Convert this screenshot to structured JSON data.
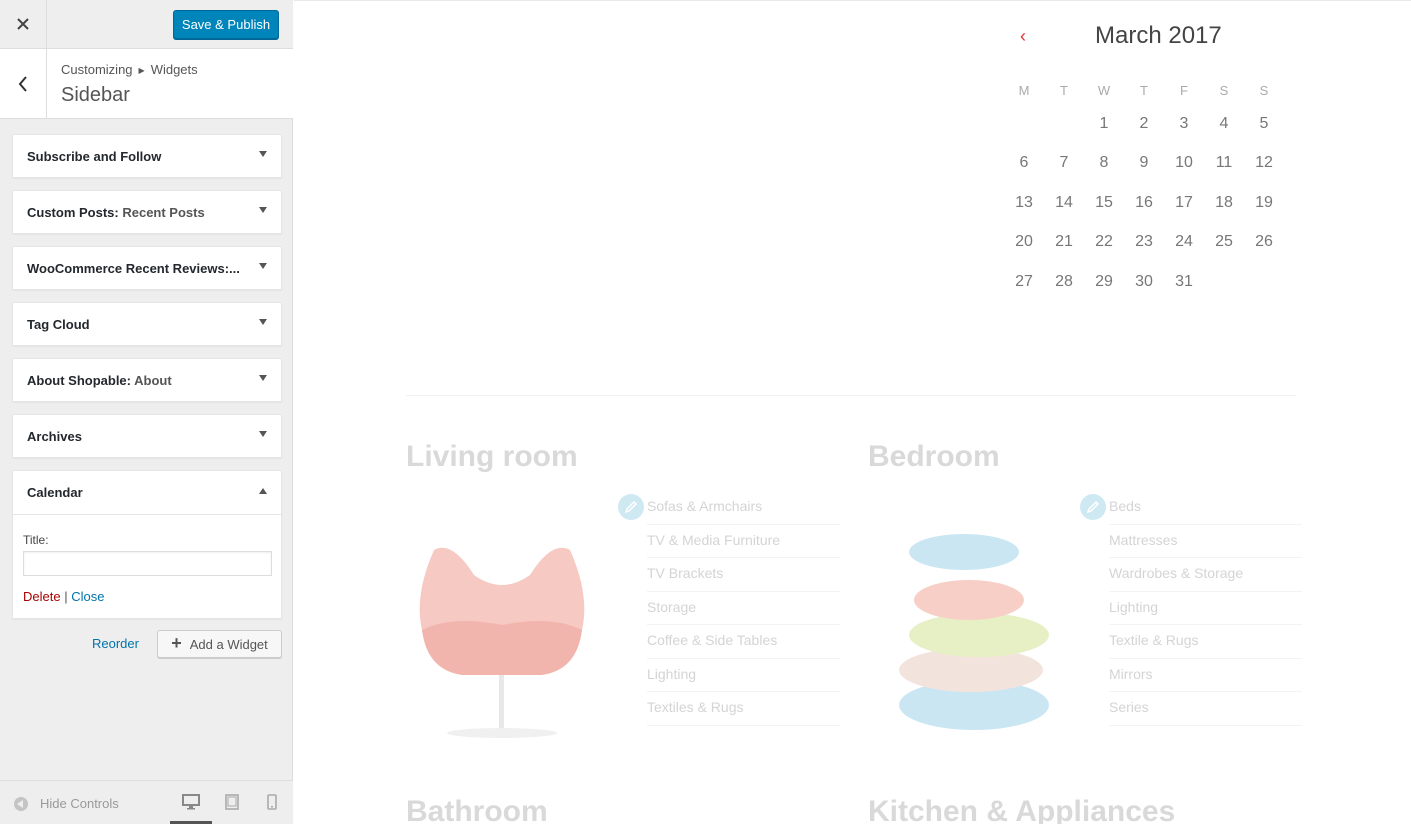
{
  "header": {
    "close_icon": "close-icon",
    "publish_label": "Save & Publish"
  },
  "section": {
    "breadcrumb": [
      "Customizing",
      "Widgets"
    ],
    "title": "Sidebar"
  },
  "widgets": [
    {
      "title": "Subscribe and Follow",
      "subtitle": ""
    },
    {
      "title": "Custom Posts:",
      "subtitle": " Recent Posts"
    },
    {
      "title": "WooCommerce Recent Reviews:...",
      "subtitle": ""
    },
    {
      "title": "Tag Cloud",
      "subtitle": ""
    },
    {
      "title": "About Shopable:",
      "subtitle": " About"
    },
    {
      "title": "Archives",
      "subtitle": ""
    }
  ],
  "calendar_widget": {
    "title": "Calendar",
    "field_label": "Title:",
    "field_value": "",
    "delete_label": "Delete",
    "separator": "|",
    "close_label": "Close"
  },
  "footer_actions": {
    "reorder_label": "Reorder",
    "add_widget_label": "Add a Widget"
  },
  "footer": {
    "hide_controls_label": "Hide Controls",
    "devices": [
      "desktop",
      "tablet",
      "mobile"
    ],
    "active_device": "desktop"
  },
  "calendar": {
    "month": "March 2017",
    "weekdays": [
      "M",
      "T",
      "W",
      "T",
      "F",
      "S",
      "S"
    ],
    "weeks": [
      [
        "",
        "",
        "1",
        "2",
        "3",
        "4",
        "5"
      ],
      [
        "6",
        "7",
        "8",
        "9",
        "10",
        "11",
        "12"
      ],
      [
        "13",
        "14",
        "15",
        "16",
        "17",
        "18",
        "19"
      ],
      [
        "20",
        "21",
        "22",
        "23",
        "24",
        "25",
        "26"
      ],
      [
        "27",
        "28",
        "29",
        "30",
        "31",
        "",
        ""
      ]
    ]
  },
  "categories": [
    {
      "title": "Living room",
      "items": [
        "Sofas & Armchairs",
        "TV & Media Furniture",
        "TV Brackets",
        "Storage",
        "Coffee & Side Tables",
        "Lighting",
        "Textiles & Rugs"
      ]
    },
    {
      "title": "Bedroom",
      "items": [
        "Beds",
        "Mattresses",
        "Wardrobes & Storage",
        "Lighting",
        "Textile & Rugs",
        "Mirrors",
        "Series"
      ]
    },
    {
      "title": "Bathroom",
      "items": []
    },
    {
      "title": "Kitchen & Appliances",
      "items": []
    }
  ],
  "colors": {
    "accent": "#0085ba",
    "link": "#0073aa",
    "delete": "#a00000",
    "calendar_prev": "#dd3333"
  }
}
